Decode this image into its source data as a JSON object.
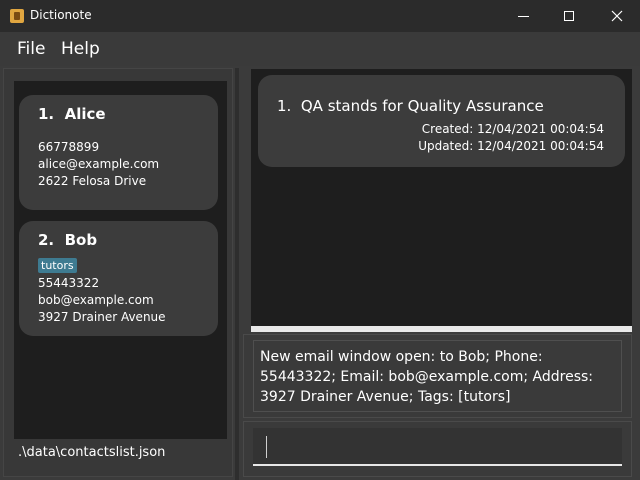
{
  "window": {
    "title": "Dictionote"
  },
  "menu": {
    "file": "File",
    "help": "Help"
  },
  "contacts": [
    {
      "index": "1.",
      "name": "Alice",
      "phone": "66778899",
      "email": "alice@example.com",
      "address": "2622 Felosa Drive"
    },
    {
      "index": "2.",
      "name": "Bob",
      "tag": "tutors",
      "phone": "55443322",
      "email": "bob@example.com",
      "address": "3927 Drainer Avenue"
    }
  ],
  "status": {
    "file_path": ".\\data\\contactslist.json"
  },
  "notes": [
    {
      "index": "1.",
      "title": "QA stands for Quality Assurance",
      "created": "Created: 12/04/2021 00:04:54",
      "updated": "Updated: 12/04/2021 00:04:54"
    }
  ],
  "result": {
    "text": "New email window open: to Bob; Phone: 55443322; Email: bob@example.com; Address: 3927 Drainer Avenue; Tags: [tutors]"
  },
  "command": {
    "value": ""
  },
  "colors": {
    "background": "#3b3b3b",
    "list_background": "#1e1e1e",
    "card": "#3c3c3c",
    "tag": "#3e7b91"
  }
}
